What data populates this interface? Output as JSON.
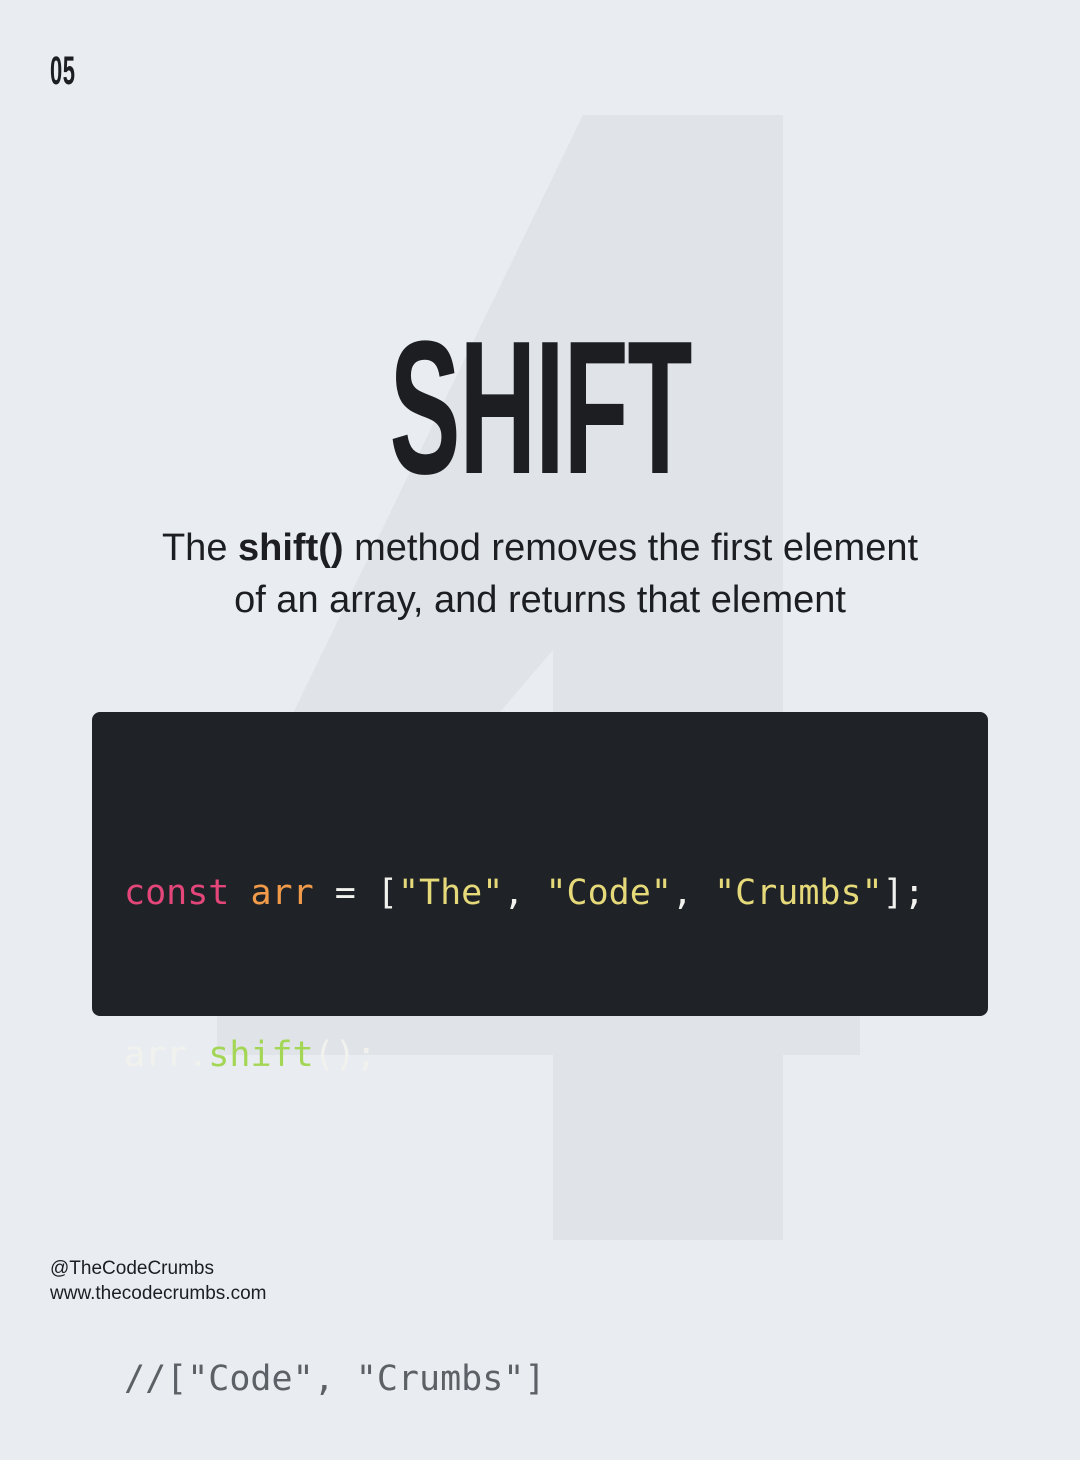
{
  "page_number": "05",
  "background_numeral": "4",
  "title": "SHIFT",
  "description": {
    "prefix": "The ",
    "method": "shift()",
    "line1_rest": " method removes the first element",
    "line2": "of an array, and returns that element"
  },
  "code": {
    "line1": [
      {
        "text": "const",
        "type": "keyword"
      },
      {
        "text": " ",
        "type": "plain"
      },
      {
        "text": "arr",
        "type": "var"
      },
      {
        "text": " = [",
        "type": "plain"
      },
      {
        "text": "\"The\"",
        "type": "string"
      },
      {
        "text": ", ",
        "type": "plain"
      },
      {
        "text": "\"Code\"",
        "type": "string"
      },
      {
        "text": ", ",
        "type": "plain"
      },
      {
        "text": "\"Crumbs\"",
        "type": "string"
      },
      {
        "text": "];",
        "type": "plain"
      }
    ],
    "line2": [
      {
        "text": "arr.",
        "type": "plain"
      },
      {
        "text": "shift",
        "type": "method"
      },
      {
        "text": "();",
        "type": "plain"
      }
    ],
    "comment": "//[\"Code\", \"Crumbs\"]"
  },
  "footer": {
    "handle": "@TheCodeCrumbs",
    "website": "www.thecodecrumbs.com"
  },
  "colors": {
    "background": "#e9edf1",
    "numeral": "#e0e4e8",
    "text": "#1c1e22",
    "code_background": "#1f2327",
    "keyword": "#e4467a",
    "variable": "#f19a4a",
    "string": "#e6d97a",
    "method": "#a3d655",
    "comment": "#5c6167"
  }
}
